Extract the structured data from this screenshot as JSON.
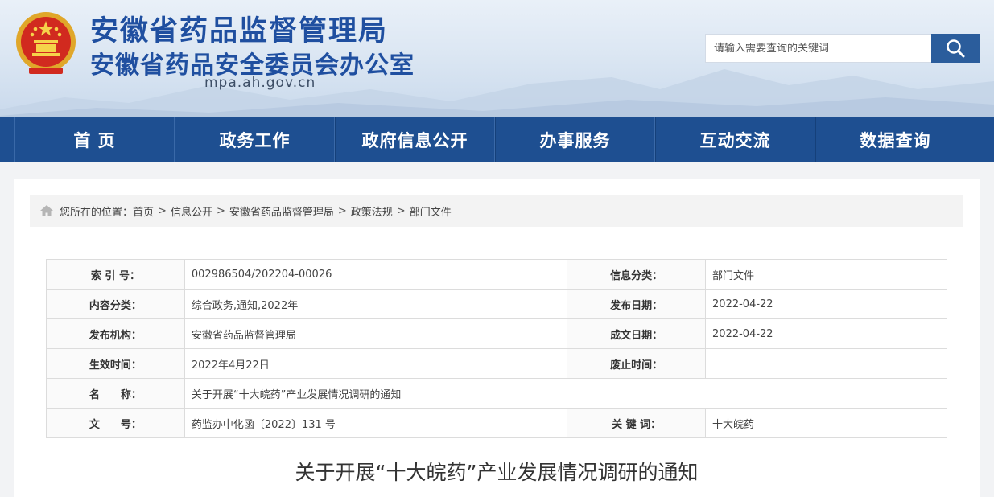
{
  "header": {
    "title_main": "安徽省药品监督管理局",
    "title_sub": "安徽省药品安全委员会办公室",
    "domain": "mpa.ah.gov.cn",
    "emblem_icon": "national-emblem-icon",
    "colors": {
      "title": "#1f4fa0",
      "nav": "#1e4f91",
      "search_button": "#2b5d9c"
    }
  },
  "search": {
    "placeholder": "请输入需要查询的关键词",
    "value": "",
    "icon": "search-icon"
  },
  "nav": {
    "items": [
      "首 页",
      "政务工作",
      "政府信息公开",
      "办事服务",
      "互动交流",
      "数据查询"
    ]
  },
  "breadcrumb": {
    "prefix": "您所在的位置：",
    "items": [
      "首页",
      "信息公开",
      "安徽省药品监督管理局",
      "政策法规",
      "部门文件"
    ],
    "separator": ">",
    "icon": "home-icon"
  },
  "meta": {
    "index_label": "索 引 号：",
    "index_value": "002986504/202204-00026",
    "info_cat_label": "信息分类：",
    "info_cat_value": "部门文件",
    "content_cat_label": "内容分类：",
    "content_cat_value": "综合政务,通知,2022年",
    "publish_date_label": "发布日期：",
    "publish_date_value": "2022-04-22",
    "org_label": "发布机构：",
    "org_value": "安徽省药品监督管理局",
    "created_date_label": "成文日期：",
    "created_date_value": "2022-04-22",
    "effective_label": "生效时间：",
    "effective_value": "2022年4月22日",
    "expiry_label": "废止时间：",
    "expiry_value": "",
    "name_label": "名　　称：",
    "name_value": "关于开展“十大皖药”产业发展情况调研的通知",
    "doc_no_label": "文　　号：",
    "doc_no_value": "药监办中化函〔2022〕131 号",
    "keywords_label": "关 键 词：",
    "keywords_value": "十大皖药"
  },
  "article": {
    "title": "关于开展“十大皖药”产业发展情况调研的通知"
  }
}
